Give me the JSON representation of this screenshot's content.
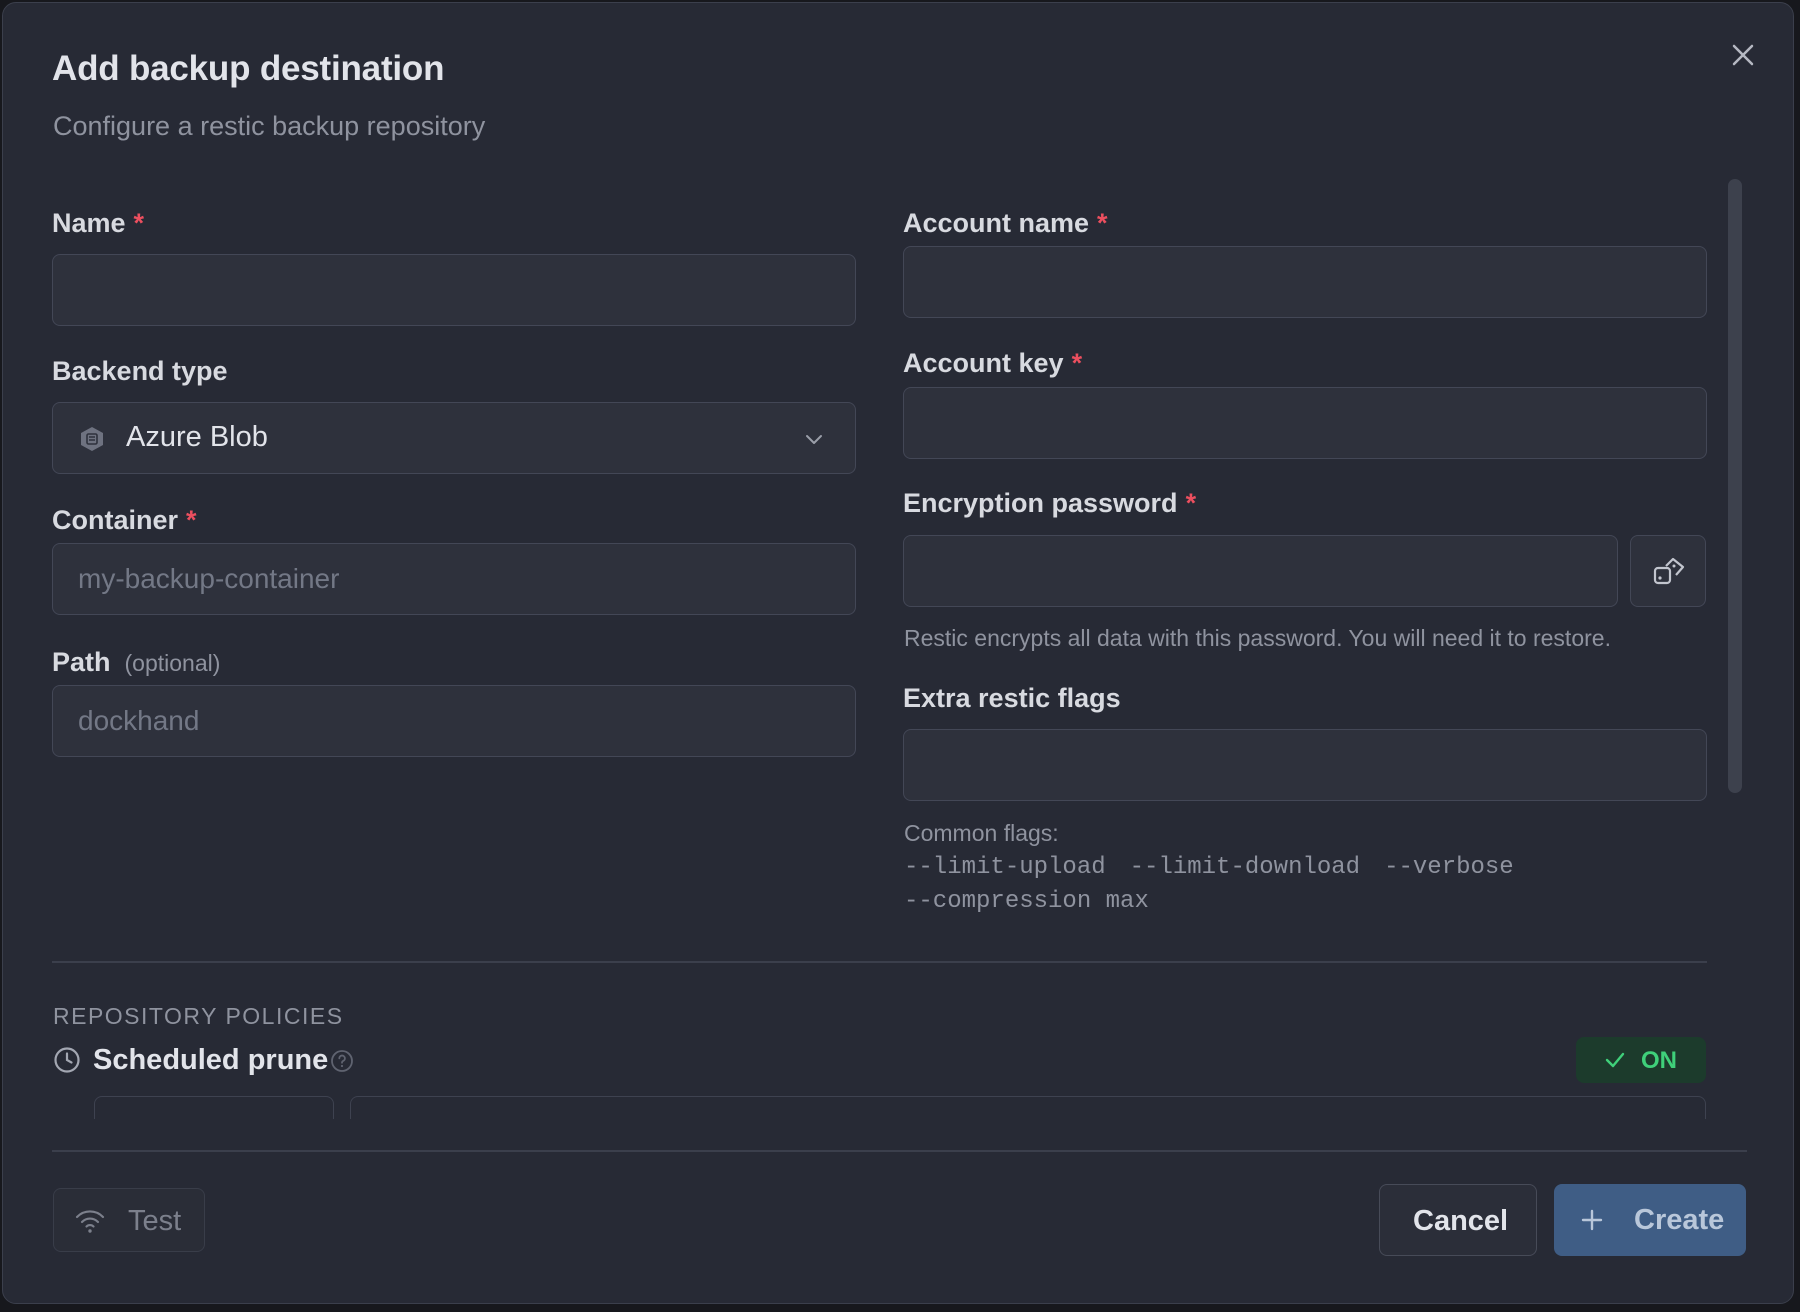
{
  "dialog": {
    "title": "Add backup destination",
    "subtitle": "Configure a restic backup repository",
    "close_icon": "close-icon"
  },
  "left": {
    "name": {
      "label": "Name",
      "required": "*",
      "value": "",
      "placeholder": ""
    },
    "backend": {
      "label": "Backend type",
      "value": "Azure Blob",
      "icon": "azure-blob-icon"
    },
    "container": {
      "label": "Container",
      "required": "*",
      "value": "",
      "placeholder": "my-backup-container"
    },
    "path": {
      "label": "Path",
      "optional": "(optional)",
      "value": "",
      "placeholder": "dockhand"
    }
  },
  "right": {
    "account_name": {
      "label": "Account name",
      "required": "*",
      "value": ""
    },
    "account_key": {
      "label": "Account key",
      "required": "*",
      "value": ""
    },
    "encryption": {
      "label": "Encryption password",
      "required": "*",
      "value": "",
      "generate_icon": "dice-icon",
      "hint": "Restic encrypts all data with this password. You will need it to restore."
    },
    "extra_flags": {
      "label": "Extra restic flags",
      "value": "",
      "common_label": "Common flags:",
      "flags": [
        "--limit-upload",
        "--limit-download",
        "--verbose",
        "--compression max"
      ]
    }
  },
  "policies": {
    "heading": "REPOSITORY POLICIES",
    "scheduled_prune": {
      "label": "Scheduled prune",
      "icon": "clock-icon",
      "help_icon": "help-icon",
      "toggle": "ON"
    }
  },
  "footer": {
    "test_label": "Test",
    "cancel_label": "Cancel",
    "create_label": "Create"
  },
  "colors": {
    "dialog_bg": "#272a35",
    "input_bg": "#2e313c",
    "required": "#ec4f5f",
    "toggle_on": "#3fd07a",
    "primary": "#3f5d85"
  }
}
